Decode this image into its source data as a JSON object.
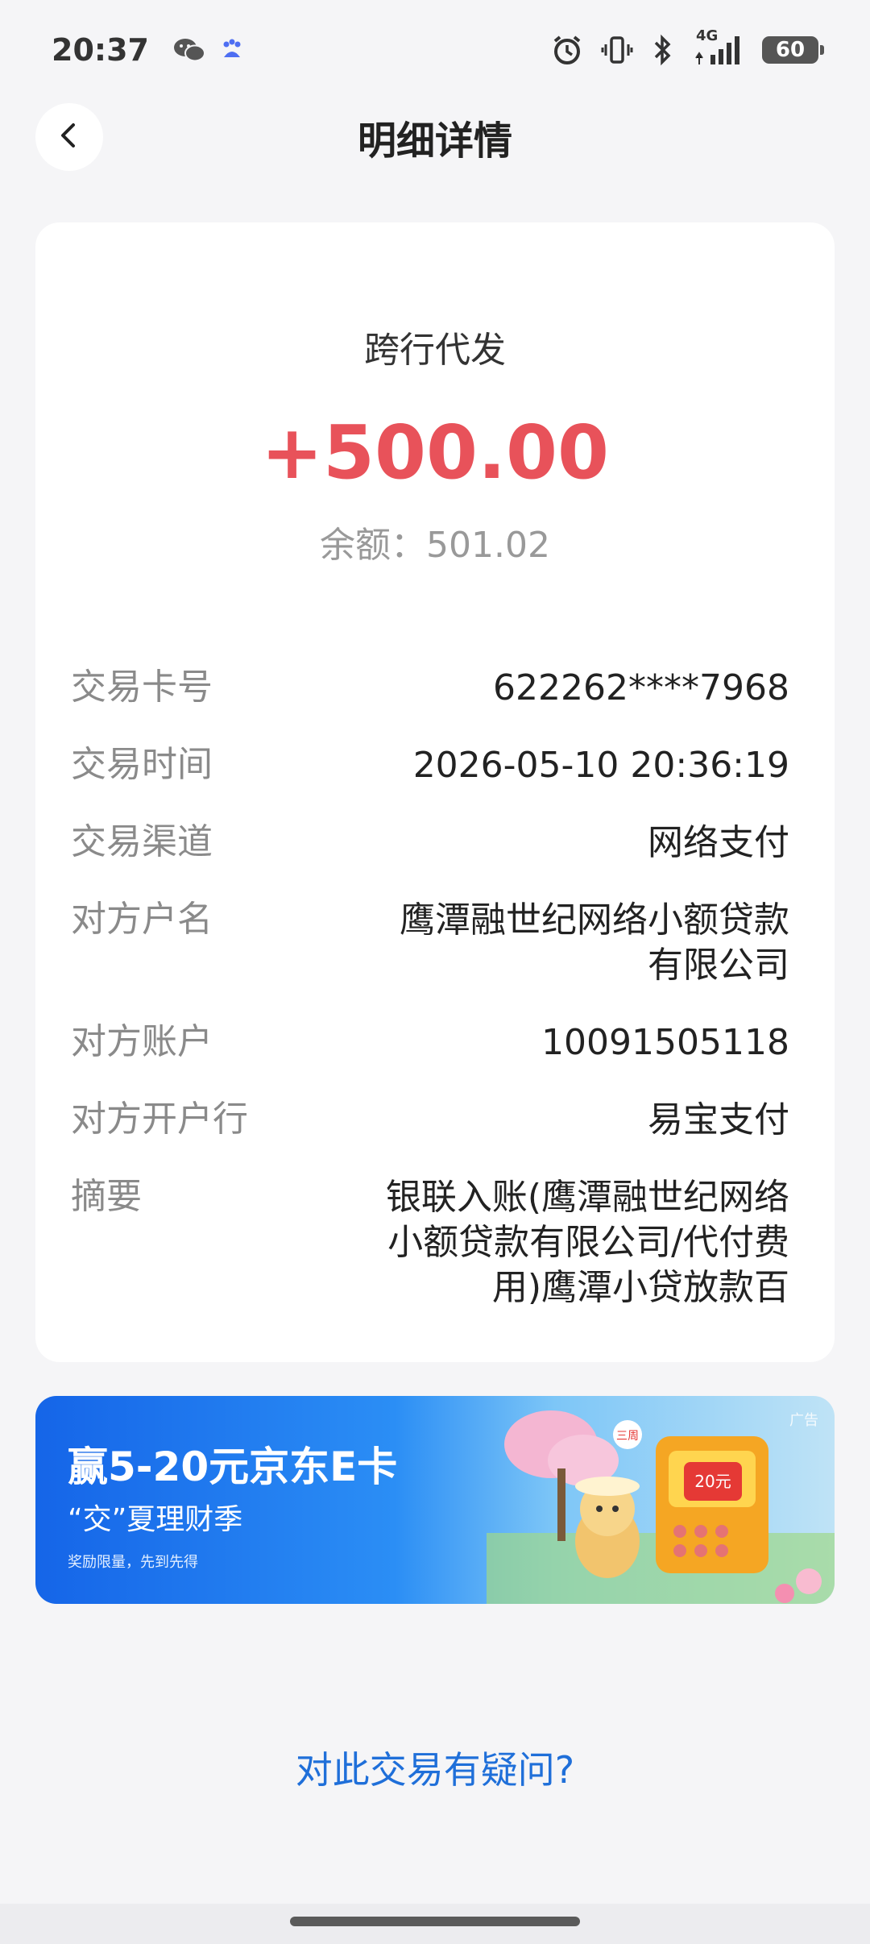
{
  "status_bar": {
    "time": "20:37",
    "network": "4G",
    "battery": "60",
    "icons": [
      "wechat-icon",
      "baidu-icon",
      "alarm-icon",
      "vibrate-icon",
      "bluetooth-icon",
      "signal-icon",
      "battery-icon"
    ]
  },
  "nav": {
    "title": "明细详情"
  },
  "transaction": {
    "type": "跨行代发",
    "amount": "+500.00",
    "balance": "余额：501.02",
    "amount_color": "#e8525a"
  },
  "details": [
    {
      "label": "交易卡号",
      "value": "622262****7968"
    },
    {
      "label": "交易时间",
      "value": "2026-05-10 20:36:19"
    },
    {
      "label": "交易渠道",
      "value": "网络支付"
    },
    {
      "label": "对方户名",
      "value": "鹰潭融世纪网络小额贷款有限公司"
    },
    {
      "label": "对方账户",
      "value": "10091505118"
    },
    {
      "label": "对方开户行",
      "value": "易宝支付"
    },
    {
      "label": "摘要",
      "value": "银联入账(鹰潭融世纪网络小额贷款有限公司/代付费用)鹰潭小贷放款百"
    }
  ],
  "banner": {
    "title": "赢5-20元京东E卡",
    "subtitle": "“交”夏理财季",
    "note": "奖励限量，先到先得",
    "ad_tag": "广告",
    "coupon": "20元",
    "sticker": "三周"
  },
  "footer": {
    "question_link": "对此交易有疑问?"
  }
}
